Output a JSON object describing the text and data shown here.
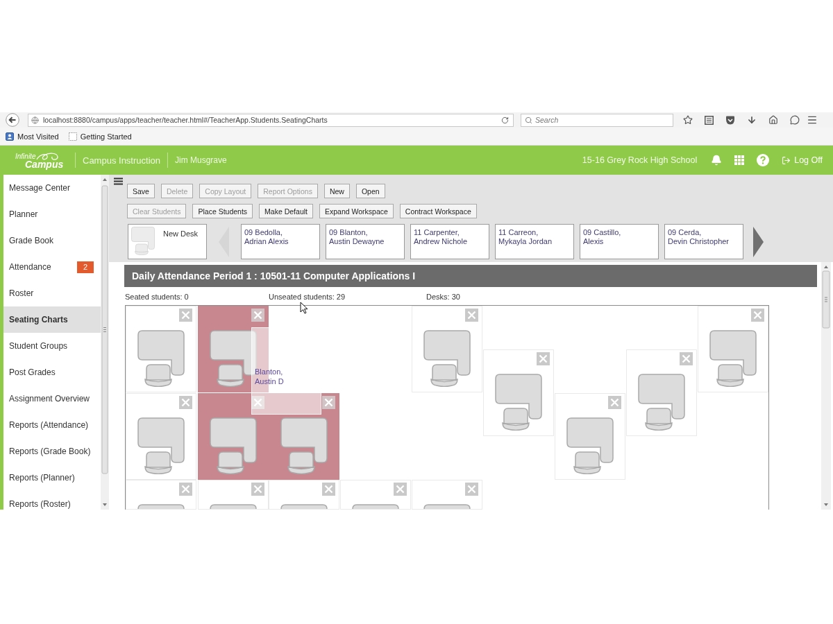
{
  "browser": {
    "url": "localhost:8880/campus/apps/teacher/teacher.html#/TeacherApp.Students.SeatingCharts",
    "search": {
      "placeholder": "Search"
    },
    "bookmarks": [
      {
        "label": "Most Visited",
        "kind": "folder"
      },
      {
        "label": "Getting Started",
        "kind": "page"
      }
    ]
  },
  "header": {
    "logo": {
      "line_1": "Infinite",
      "line_2": "Campus"
    },
    "app": "Campus Instruction",
    "user": "Jim Musgrave",
    "school": "15-16 Grey Rock High School",
    "logoff": "Log Off"
  },
  "sidebar": {
    "items": [
      {
        "label": "Message Center",
        "selected": false
      },
      {
        "label": "Planner",
        "selected": false
      },
      {
        "label": "Grade Book",
        "selected": false
      },
      {
        "label": "Attendance",
        "selected": false,
        "badge": "2"
      },
      {
        "label": "Roster",
        "selected": false
      },
      {
        "label": "Seating Charts",
        "selected": true
      },
      {
        "label": "Student Groups",
        "selected": false
      },
      {
        "label": "Post Grades",
        "selected": false
      },
      {
        "label": "Assignment Overview",
        "selected": false
      },
      {
        "label": "Reports (Attendance)",
        "selected": false
      },
      {
        "label": "Reports (Grade Book)",
        "selected": false
      },
      {
        "label": "Reports (Planner)",
        "selected": false
      },
      {
        "label": "Reports (Roster)",
        "selected": false
      }
    ]
  },
  "toolbar": {
    "rows": [
      {
        "buttons": [
          {
            "label": "Save",
            "disabled": false
          },
          {
            "label": "Delete",
            "disabled": true
          },
          {
            "label": "Copy Layout",
            "disabled": true
          },
          {
            "label": "Report Options",
            "disabled": true
          },
          {
            "label": "New",
            "disabled": false
          },
          {
            "label": "Open",
            "disabled": false
          }
        ]
      },
      {
        "buttons": [
          {
            "label": "Clear Students",
            "disabled": true
          },
          {
            "label": "Place Students",
            "disabled": false
          },
          {
            "label": "Make Default",
            "disabled": false
          },
          {
            "label": "Expand Workspace",
            "disabled": false
          },
          {
            "label": "Contract Workspace",
            "disabled": false
          }
        ]
      }
    ]
  },
  "palette": {
    "new_desk": "New Desk",
    "prev": {
      "disabled": true
    },
    "students": [
      {
        "lines": [
          "09 Bedolla,",
          "Adrian Alexis"
        ]
      },
      {
        "lines": [
          "09 Blanton,",
          "Austin Dewayne"
        ]
      },
      {
        "lines": [
          "11 Carpenter,",
          "Andrew Nichole"
        ]
      },
      {
        "lines": [
          "11 Carreon,",
          "Mykayla Jordan"
        ]
      },
      {
        "lines": [
          "09 Castillo,",
          "Alexis"
        ]
      },
      {
        "lines": [
          "09 Cerda,",
          "Devin Christopher"
        ]
      }
    ],
    "next": {
      "disabled": false
    }
  },
  "seating_chart": {
    "title": "Daily Attendance Period 1 : 10501-11 Computer Applications I",
    "stats": [
      "Seated students: 0",
      "Unseated students: 29",
      "Desks: 30"
    ],
    "desks": [
      {
        "highlighted": false
      },
      {
        "highlighted": true
      },
      {
        "highlighted": false
      },
      {
        "highlighted": false
      },
      {
        "highlighted": false
      },
      {
        "highlighted": false
      },
      {
        "highlighted": false
      },
      {
        "highlighted": true
      },
      {
        "highlighted": true
      },
      {
        "highlighted": false
      },
      {
        "highlighted": false
      },
      {
        "highlighted": false
      },
      {
        "highlighted": false
      },
      {
        "highlighted": false
      },
      {
        "highlighted": false
      }
    ],
    "drag_preview": {
      "lines": [
        "Blanton,",
        "Austin D"
      ]
    }
  }
}
